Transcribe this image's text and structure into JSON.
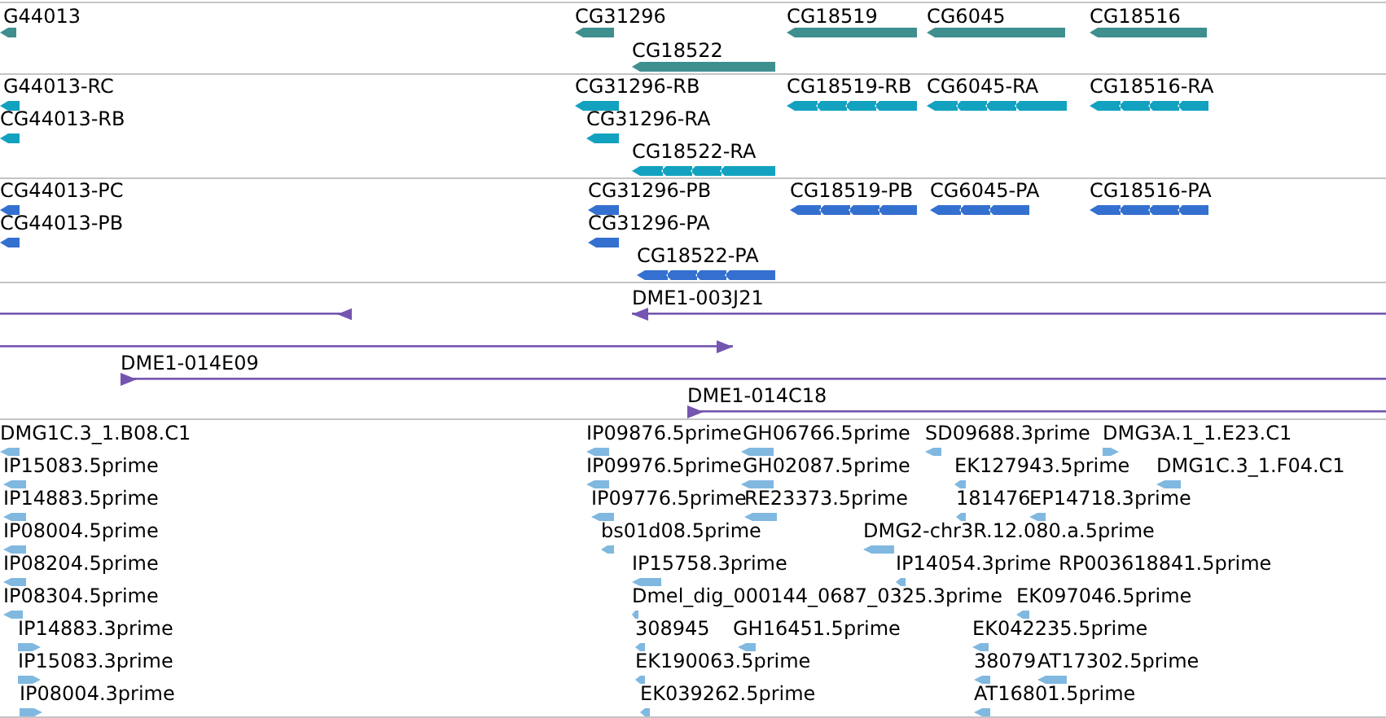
{
  "tracks": [
    {
      "kind": "gene",
      "color": "#3f8f8f",
      "rows": [
        [
          {
            "label": "G44013",
            "reverse": true
          },
          {
            "label": "CG31296",
            "reverse": true
          },
          {
            "label": "CG18519",
            "reverse": true
          },
          {
            "label": "CG6045",
            "reverse": true
          },
          {
            "label": "CG18516",
            "reverse": true
          }
        ],
        [
          {
            "label": "CG18522",
            "reverse": true
          }
        ]
      ]
    },
    {
      "kind": "transcript",
      "color": "#12a2c0",
      "rows": [
        [
          {
            "label": "G44013-RC",
            "reverse": true
          },
          {
            "label": "CG31296-RB",
            "reverse": true
          },
          {
            "label": "CG18519-RB",
            "reverse": true
          },
          {
            "label": "CG6045-RA",
            "reverse": true
          },
          {
            "label": "CG18516-RA",
            "reverse": true
          }
        ],
        [
          {
            "label": "CG44013-RB",
            "reverse": true
          },
          {
            "label": "CG31296-RA",
            "reverse": true
          }
        ],
        [
          {
            "label": "CG18522-RA",
            "reverse": true
          }
        ]
      ]
    },
    {
      "kind": "protein",
      "color": "#3470d0",
      "rows": [
        [
          {
            "label": "CG44013-PC",
            "reverse": true
          },
          {
            "label": "CG31296-PB",
            "reverse": true
          },
          {
            "label": "CG18519-PB",
            "reverse": true
          },
          {
            "label": "CG6045-PA",
            "reverse": true
          },
          {
            "label": "CG18516-PA",
            "reverse": true
          }
        ],
        [
          {
            "label": "CG44013-PB",
            "reverse": true
          },
          {
            "label": "CG31296-PA",
            "reverse": true
          }
        ],
        [
          {
            "label": "CG18522-PA",
            "reverse": true
          }
        ]
      ]
    },
    {
      "kind": "clone",
      "color": "#7455b0",
      "rows": [
        [
          {
            "reverse": true
          },
          {
            "label": "DME1-003J21",
            "reverse": true
          }
        ],
        [
          {
            "reverse": false
          }
        ],
        [
          {
            "label": "DME1-014E09",
            "reverse": false
          }
        ],
        [
          {
            "label": "DME1-014C18",
            "reverse": false
          }
        ]
      ]
    },
    {
      "kind": "est",
      "color": "#80b8e0",
      "rows": [
        [
          {
            "label": "DMG1C.3_1.B08.C1",
            "reverse": true
          },
          {
            "label": "IP09876.5prime",
            "reverse": true
          },
          {
            "label": "GH06766.5prime",
            "reverse": true
          },
          {
            "label": "SD09688.3prime",
            "reverse": true
          },
          {
            "label": "DMG3A.1_1.E23.C1",
            "reverse": false
          }
        ],
        [
          {
            "label": "IP15083.5prime",
            "reverse": true
          },
          {
            "label": "IP09976.5prime",
            "reverse": true
          },
          {
            "label": "GH02087.5prime",
            "reverse": true
          },
          {
            "label": "EK127943.5prime",
            "reverse": true
          },
          {
            "label": "DMG1C.3_1.F04.C1",
            "reverse": true
          }
        ],
        [
          {
            "label": "IP14883.5prime",
            "reverse": true
          },
          {
            "label": "IP09776.5prime",
            "reverse": true
          },
          {
            "label": "RE23373.5prime",
            "reverse": true
          },
          {
            "label": "181476",
            "reverse": true
          },
          {
            "label": "EP14718.3prime",
            "reverse": true
          }
        ],
        [
          {
            "label": "IP08004.5prime",
            "reverse": true
          },
          {
            "label": "bs01d08.5prime",
            "reverse": true
          },
          {
            "label": "DMG2-chr3R.12.080.a.5prime",
            "reverse": true
          }
        ],
        [
          {
            "label": "IP08204.5prime",
            "reverse": true
          },
          {
            "label": "IP15758.3prime",
            "reverse": true
          },
          {
            "label": "IP14054.3prime",
            "reverse": true
          },
          {
            "label": "RP003618841.5prime"
          }
        ],
        [
          {
            "label": "IP08304.5prime",
            "reverse": true
          },
          {
            "label": "Dmel_dig_000144_0687_0325.3prime",
            "reverse": true
          },
          {
            "label": "EK097046.5prime",
            "reverse": true
          }
        ],
        [
          {
            "label": "IP14883.3prime",
            "reverse": false
          },
          {
            "label": "308945",
            "reverse": true
          },
          {
            "label": "GH16451.5prime",
            "reverse": true
          },
          {
            "label": "EK042235.5prime",
            "reverse": true
          }
        ],
        [
          {
            "label": "IP15083.3prime",
            "reverse": false
          },
          {
            "label": "EK190063.5prime",
            "reverse": true
          },
          {
            "label": "38079",
            "reverse": true
          },
          {
            "label": "AT17302.5prime",
            "reverse": true
          }
        ],
        [
          {
            "label": "IP08004.3prime",
            "reverse": false
          },
          {
            "label": "EK039262.5prime",
            "reverse": true
          },
          {
            "label": "AT16801.5prime",
            "reverse": true
          }
        ]
      ]
    }
  ]
}
